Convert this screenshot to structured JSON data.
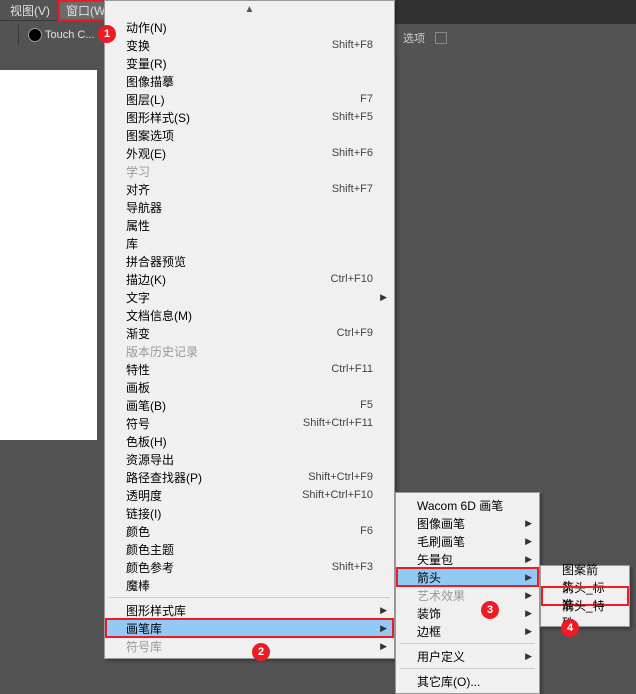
{
  "menubar": {
    "view": "视图(V)",
    "window": "窗口(W)"
  },
  "toolbar": {
    "brush_label": "Touch C..."
  },
  "options": {
    "item1": "选项",
    "item2": ""
  },
  "markers": {
    "m1": "1",
    "m2": "2",
    "m3": "3",
    "m4": "4"
  },
  "menu": {
    "actions": "动作(N)",
    "transform": "变换",
    "transform_sc": "Shift+F8",
    "variables": "变量(R)",
    "image_trace": "图像描摹",
    "layers": "图层(L)",
    "layers_sc": "F7",
    "graphic_styles": "图形样式(S)",
    "graphic_styles_sc": "Shift+F5",
    "pattern_options": "图案选项",
    "appearance": "外观(E)",
    "appearance_sc": "Shift+F6",
    "learning": "学习",
    "align": "对齐",
    "align_sc": "Shift+F7",
    "navigator": "导航器",
    "attributes": "属性",
    "library": "库",
    "flattener": "拼合器预览",
    "stroke": "描边(K)",
    "stroke_sc": "Ctrl+F10",
    "type": "文字",
    "doc_info": "文档信息(M)",
    "gradient": "渐变",
    "gradient_sc": "Ctrl+F9",
    "history": "版本历史记录",
    "properties": "特性",
    "properties_sc": "Ctrl+F11",
    "artboards": "画板",
    "brushes": "画笔(B)",
    "brushes_sc": "F5",
    "symbols": "符号",
    "symbols_sc": "Shift+Ctrl+F11",
    "swatches": "色板(H)",
    "asset_export": "资源导出",
    "pathfinder": "路径查找器(P)",
    "pathfinder_sc": "Shift+Ctrl+F9",
    "transparency": "透明度",
    "transparency_sc": "Shift+Ctrl+F10",
    "links": "链接(I)",
    "color": "颜色",
    "color_sc": "F6",
    "color_themes": "颜色主题",
    "color_guide": "颜色参考",
    "color_guide_sc": "Shift+F3",
    "magic_wand": "魔棒",
    "graphic_style_lib": "图形样式库",
    "brush_lib": "画笔库",
    "symbol_lib": "符号库"
  },
  "sub1": {
    "wacom": "Wacom 6D 画笔",
    "image_brush": "图像画笔",
    "bristle": "毛刷画笔",
    "vector_pack": "矢量包",
    "arrows": "箭头",
    "art_effects": "艺术效果",
    "decorative": "装饰",
    "border": "边框",
    "user_defined": "用户定义",
    "other_lib": "其它库(O)..."
  },
  "sub2": {
    "pattern_arrows": "图案箭头",
    "standard_arrows": "箭头_标准",
    "special_arrows": "箭头_特殊"
  }
}
